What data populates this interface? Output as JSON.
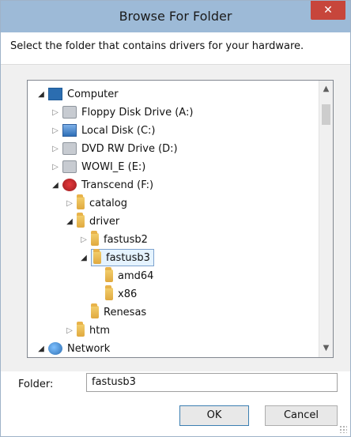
{
  "window": {
    "title": "Browse For Folder",
    "close_glyph": "✕"
  },
  "prompt": "Select the folder that contains drivers for your hardware.",
  "tree": {
    "items": [
      {
        "label": "Computer",
        "icon": "computer-icon",
        "expander": "open"
      },
      {
        "label": "Floppy Disk Drive (A:)",
        "icon": "floppy-drive-icon",
        "expander": "closed"
      },
      {
        "label": "Local Disk (C:)",
        "icon": "local-disk-icon",
        "expander": "closed"
      },
      {
        "label": "DVD RW Drive (D:)",
        "icon": "dvd-drive-icon",
        "expander": "closed"
      },
      {
        "label": "WOWI_E (E:)",
        "icon": "removable-drive-icon",
        "expander": "closed"
      },
      {
        "label": "Transcend (F:)",
        "icon": "transcend-drive-icon",
        "expander": "open"
      },
      {
        "label": "catalog",
        "icon": "folder-icon",
        "expander": "closed"
      },
      {
        "label": "driver",
        "icon": "folder-icon",
        "expander": "open"
      },
      {
        "label": "fastusb2",
        "icon": "folder-icon",
        "expander": "closed"
      },
      {
        "label": "fastusb3",
        "icon": "folder-icon",
        "expander": "open",
        "selected": true
      },
      {
        "label": "amd64",
        "icon": "folder-icon",
        "expander": "none"
      },
      {
        "label": "x86",
        "icon": "folder-icon",
        "expander": "none"
      },
      {
        "label": "Renesas",
        "icon": "folder-icon",
        "expander": "none"
      },
      {
        "label": "htm",
        "icon": "folder-icon",
        "expander": "closed"
      },
      {
        "label": "Network",
        "icon": "network-icon",
        "expander": "open"
      }
    ]
  },
  "folder_field": {
    "label": "Folder:",
    "value": "fastusb3"
  },
  "buttons": {
    "ok": "OK",
    "cancel": "Cancel"
  },
  "colors": {
    "titlebar": "#9dbad7",
    "close": "#c7463b",
    "selection": "#e5f3ff"
  }
}
